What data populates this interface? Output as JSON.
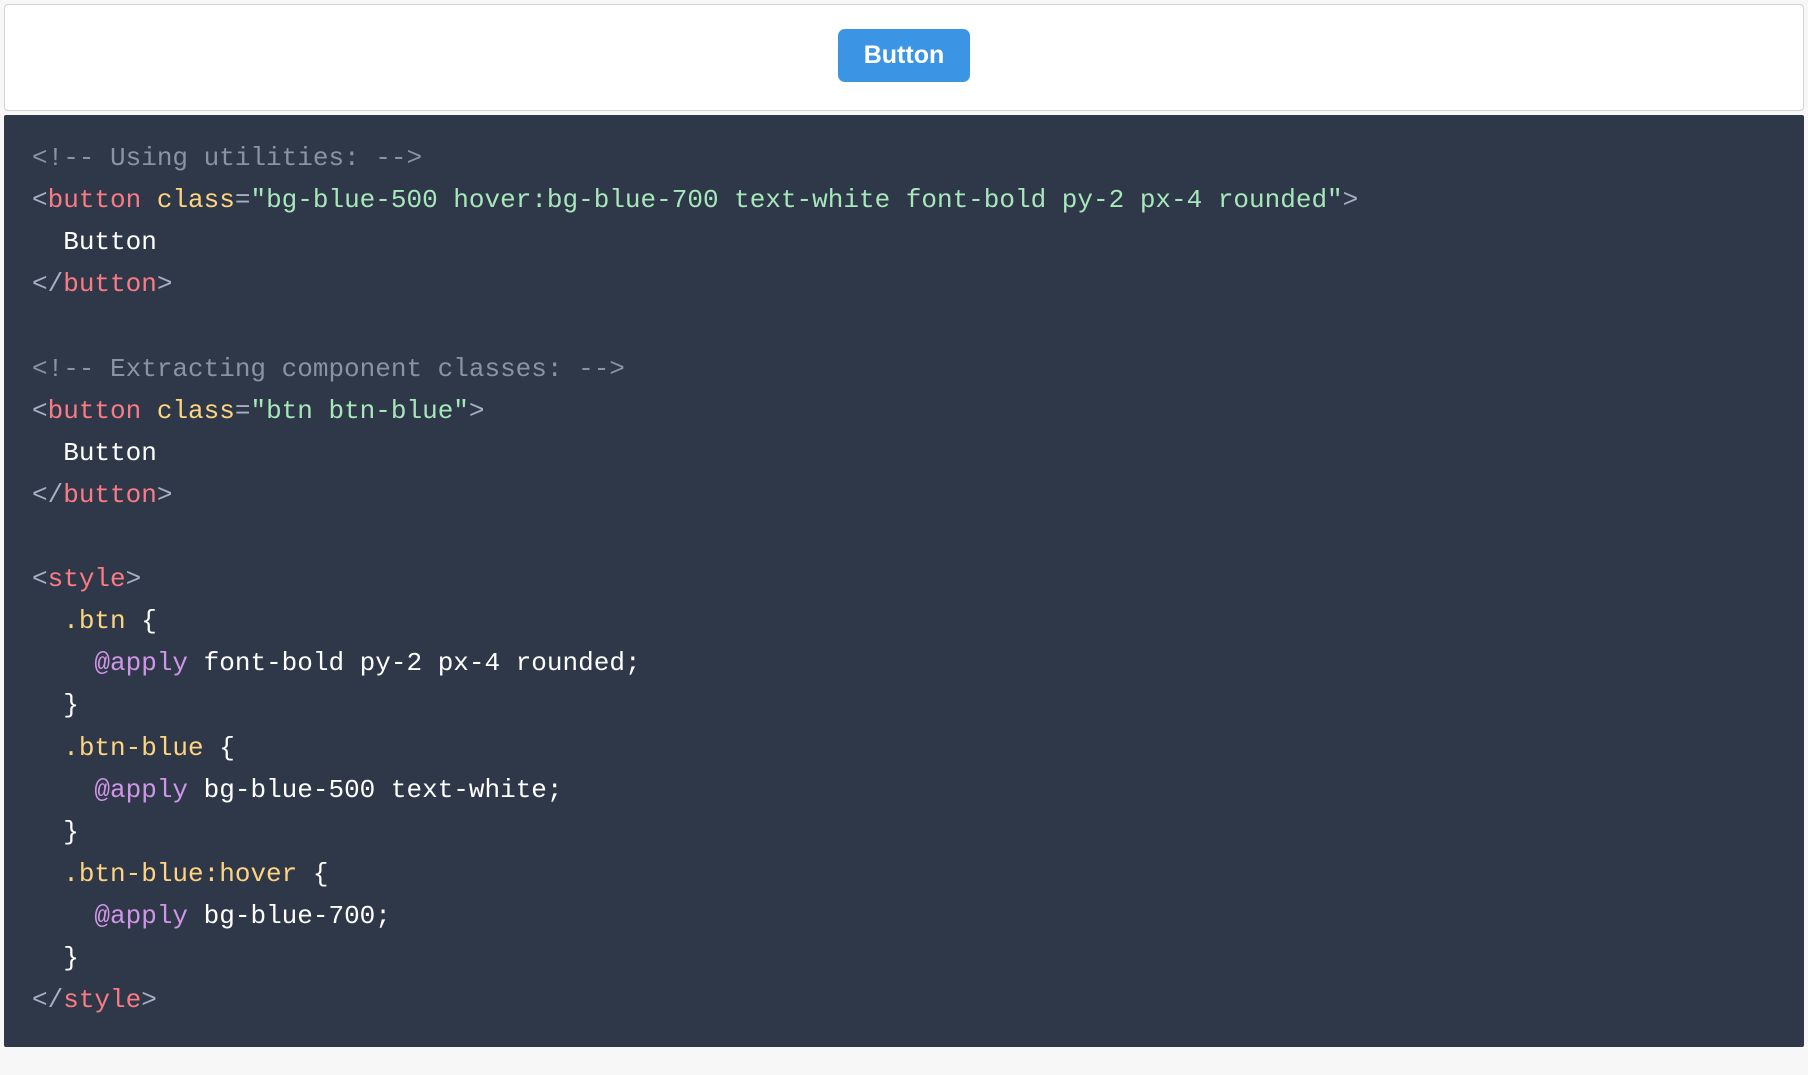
{
  "preview": {
    "button_label": "Button"
  },
  "code": {
    "comment1": "<!-- Using utilities: -->",
    "tag_button": "button",
    "attr_class": "class",
    "class_utilities": "\"bg-blue-500 hover:bg-blue-700 text-white font-bold py-2 px-4 rounded\"",
    "button_text": "Button",
    "comment2": "<!-- Extracting component classes: -->",
    "class_component": "\"btn btn-blue\"",
    "tag_style": "style",
    "sel_btn": ".btn",
    "apply_kw": "@apply",
    "btn_rule": "font-bold py-2 px-4 rounded",
    "sel_btn_blue": ".btn-blue",
    "btn_blue_rule": "bg-blue-500 text-white",
    "sel_btn_blue_hover": ".btn-blue:hover",
    "btn_blue_hover_rule": "bg-blue-700",
    "lt": "<",
    "lt_slash": "</",
    "gt": ">",
    "eq": "=",
    "sp": " ",
    "indent1": "  ",
    "indent2": "    ",
    "brace_open": " {",
    "brace_close": "}",
    "semicolon": ";"
  }
}
